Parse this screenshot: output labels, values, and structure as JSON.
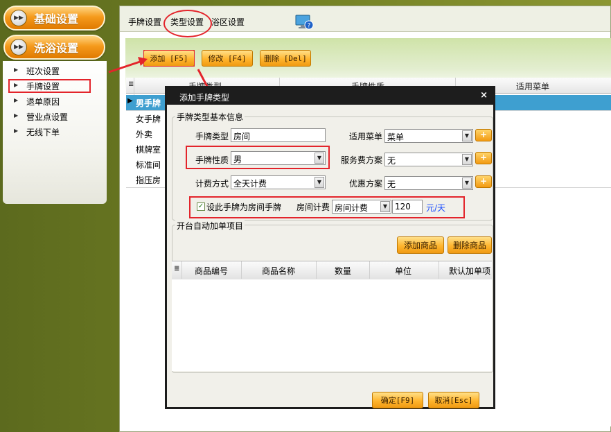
{
  "nav": {
    "basic_settings": "基础设置",
    "bath_settings": "洗浴设置",
    "items": [
      {
        "label": "班次设置"
      },
      {
        "label": "手牌设置"
      },
      {
        "label": "退单原因"
      },
      {
        "label": "营业点设置"
      },
      {
        "label": "无线下单"
      }
    ]
  },
  "tabs": [
    {
      "label": "手牌设置"
    },
    {
      "label": "类型设置"
    },
    {
      "label": "浴区设置"
    }
  ],
  "toolbar": {
    "add": "添加 [F5]",
    "edit": "修改 [F4]",
    "delete": "删除 [Del]"
  },
  "grid": {
    "headers": [
      "手牌类型",
      "手牌性质",
      "适用菜单"
    ],
    "rows": [
      {
        "type": "男手牌"
      },
      {
        "type": "女手牌"
      },
      {
        "type": "外卖"
      },
      {
        "type": "棋牌室"
      },
      {
        "type": "标准间"
      },
      {
        "type": "指压房"
      }
    ]
  },
  "dialog": {
    "title": "添加手牌类型",
    "close": "×",
    "basic_group": "手牌类型基本信息",
    "type_label": "手牌类型",
    "type_value": "房间",
    "menu_label": "适用菜单",
    "menu_value": "菜单",
    "nature_label": "手牌性质",
    "nature_value": "男",
    "service_label": "服务费方案",
    "service_value": "无",
    "billing_label": "计费方式",
    "billing_value": "全天计费",
    "discount_label": "优惠方案",
    "discount_value": "无",
    "room_checkbox": "设此手牌为房间手牌",
    "room_checked": true,
    "room_billing_label": "房间计费",
    "room_billing_value": "房间计费",
    "price_value": "120",
    "unit": "元/天",
    "auto_group": "开台自动加单项目",
    "add_goods": "添加商品",
    "delete_goods": "删除商品",
    "goods_headers": [
      "商品编号",
      "商品名称",
      "数量",
      "单位",
      "默认加单项"
    ],
    "ok": "确定[F9]",
    "cancel": "取消[Esc]",
    "plus": "+"
  },
  "colors": {
    "accent_orange": "#f59a1c",
    "selected_row": "#3e9fd0",
    "highlight_red": "#e3242b",
    "unit_blue": "#1a4cff"
  }
}
